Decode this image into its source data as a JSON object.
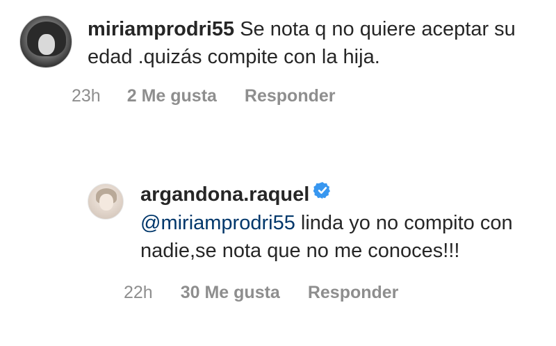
{
  "comments": [
    {
      "username": "miriamprodri55",
      "text": "Se nota q no quiere aceptar su edad .quizás compite con la hija.",
      "time": "23h",
      "likes": "2 Me gusta",
      "reply": "Responder"
    },
    {
      "username": "argandona.raquel",
      "verified": true,
      "mention": "@miriamprodri55",
      "text": "linda yo no compito con nadie,se nota que no me conoces!!!",
      "time": "22h",
      "likes": "30 Me gusta",
      "reply": "Responder"
    }
  ],
  "colors": {
    "text": "#262626",
    "meta": "#8e8e8e",
    "mention": "#00376b",
    "verified": "#3897f0"
  },
  "icons": {
    "verified": "verified-badge-icon"
  }
}
